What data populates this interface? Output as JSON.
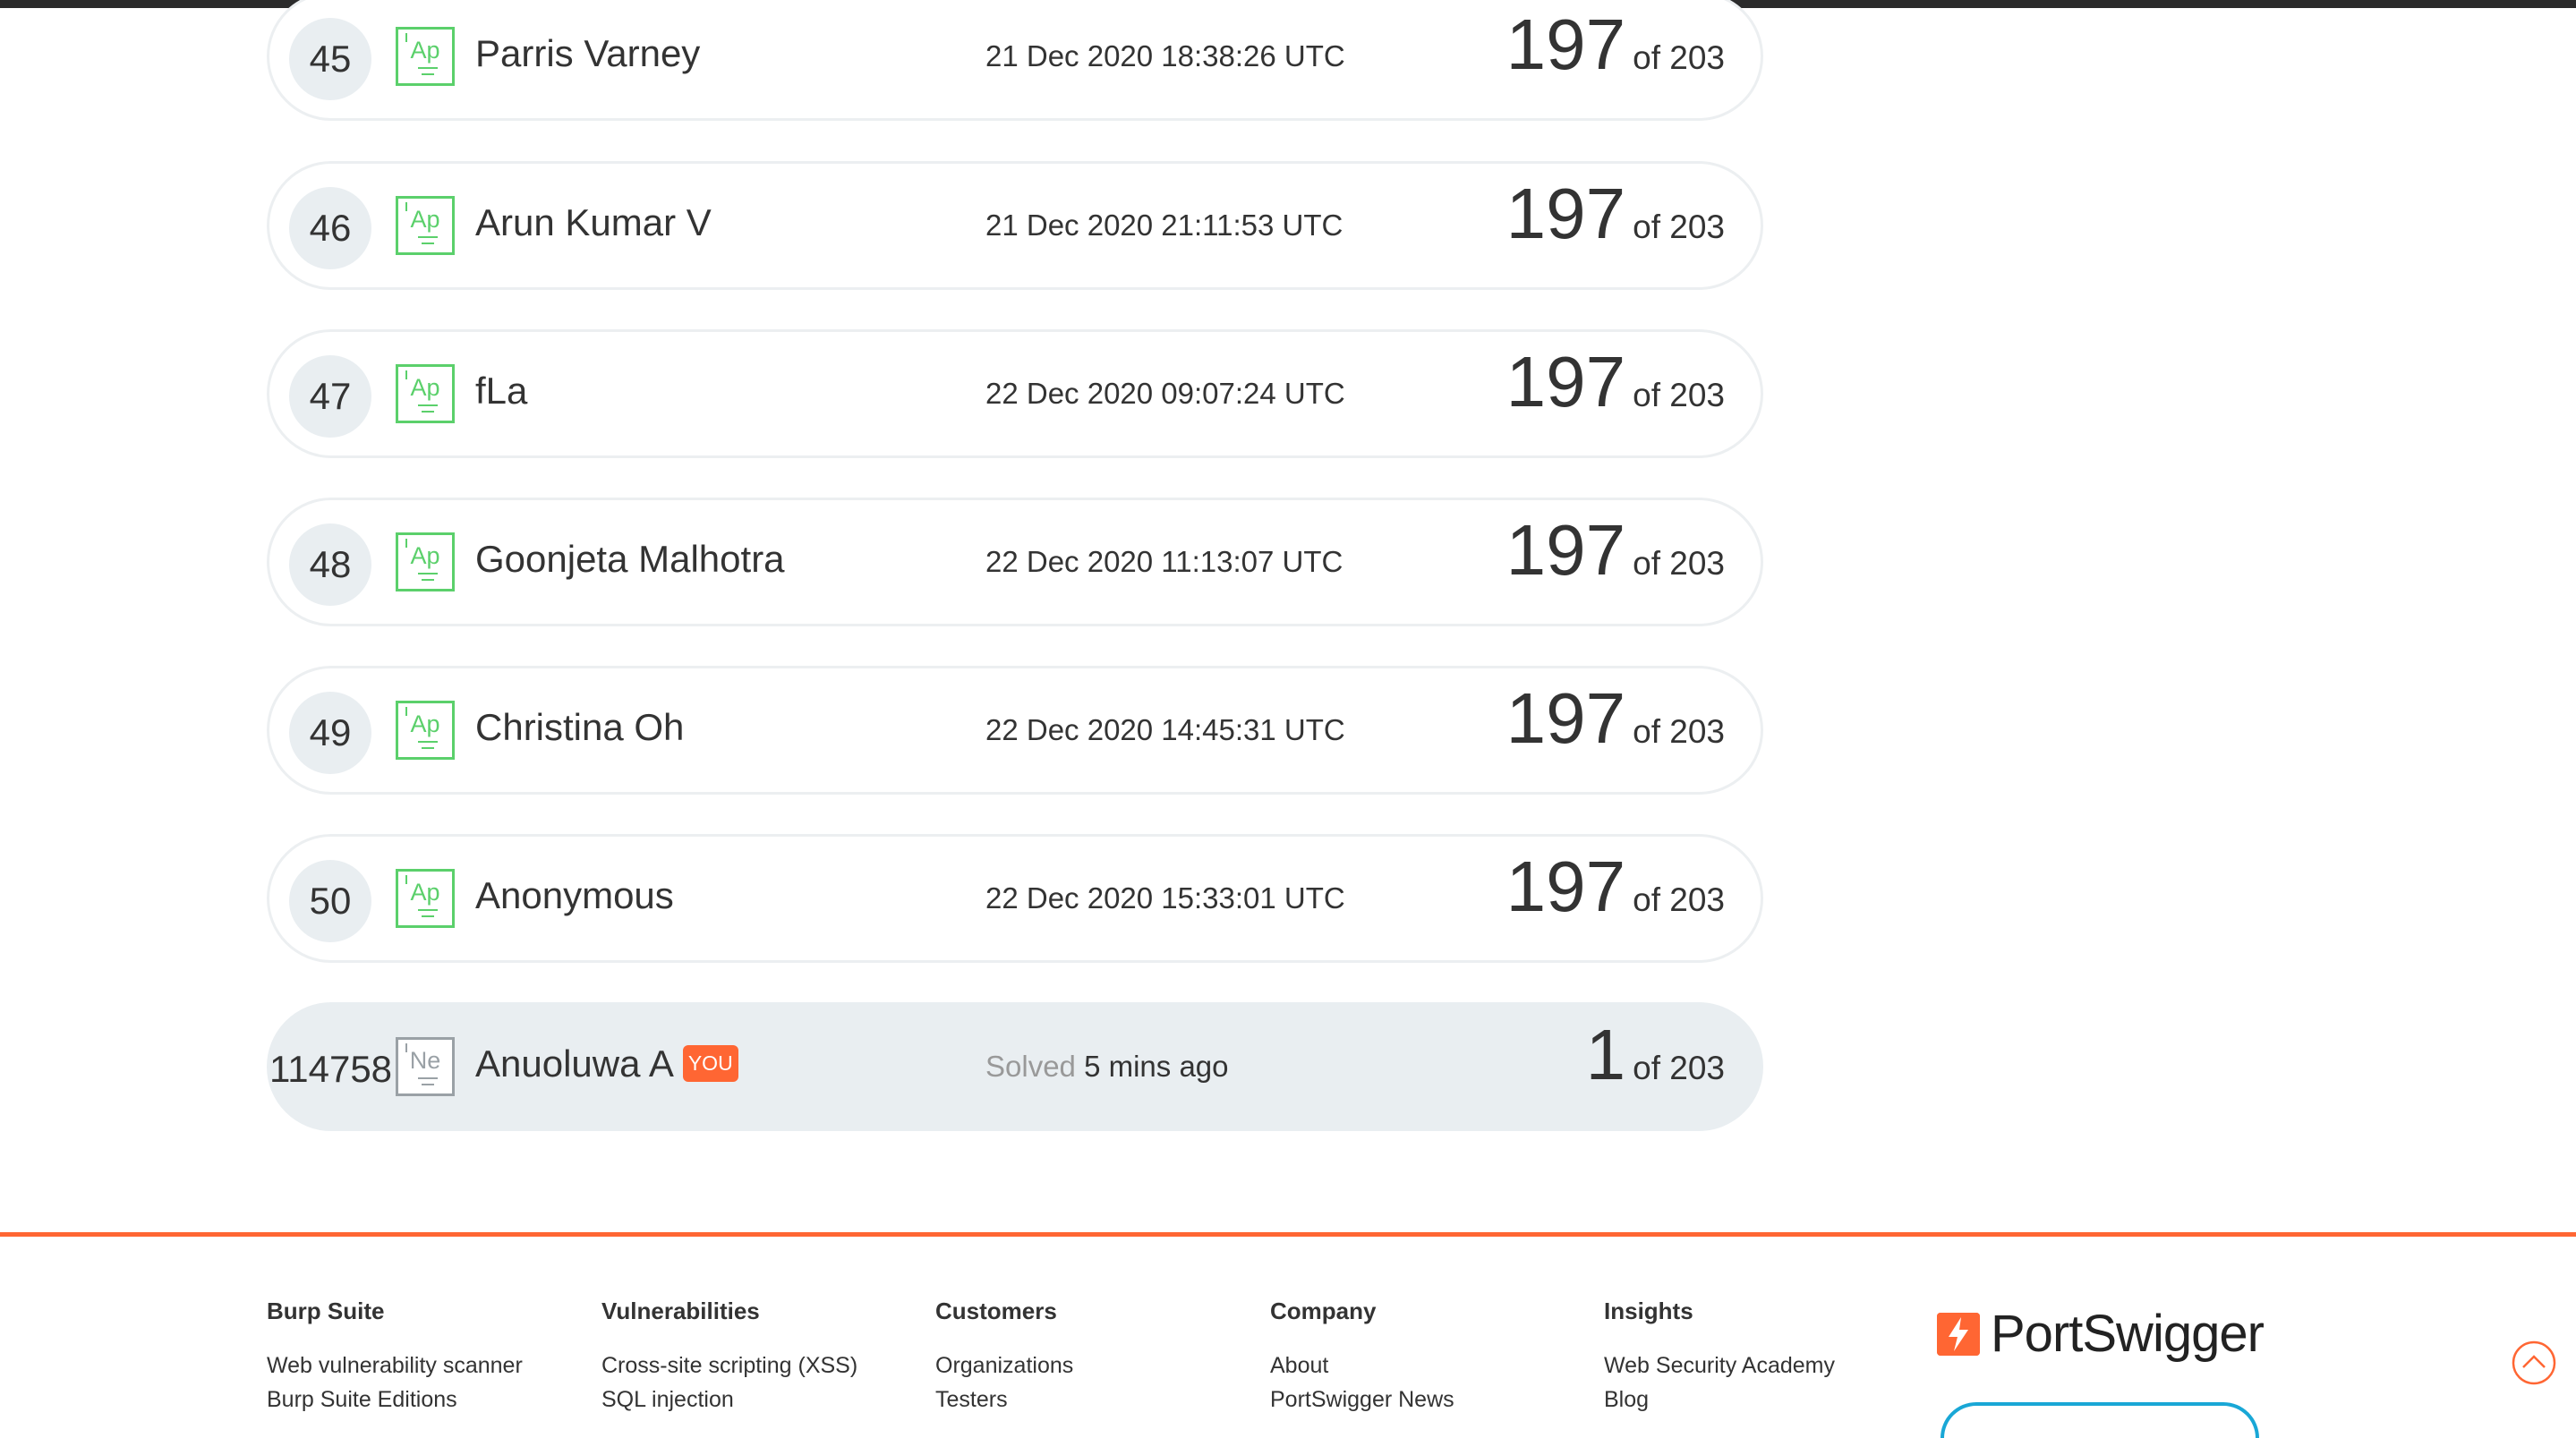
{
  "leaderboard": {
    "rows": [
      {
        "rank": "45",
        "badge": "Ap",
        "name": "Parris Varney",
        "time": "21 Dec 2020 18:38:26 UTC",
        "score": "197",
        "of": "of 203"
      },
      {
        "rank": "46",
        "badge": "Ap",
        "name": "Arun Kumar V",
        "time": "21 Dec 2020 21:11:53 UTC",
        "score": "197",
        "of": "of 203"
      },
      {
        "rank": "47",
        "badge": "Ap",
        "name": "fLa",
        "time": "22 Dec 2020 09:07:24 UTC",
        "score": "197",
        "of": "of 203"
      },
      {
        "rank": "48",
        "badge": "Ap",
        "name": "Goonjeta Malhotra",
        "time": "22 Dec 2020 11:13:07 UTC",
        "score": "197",
        "of": "of 203"
      },
      {
        "rank": "49",
        "badge": "Ap",
        "name": "Christina Oh",
        "time": "22 Dec 2020 14:45:31 UTC",
        "score": "197",
        "of": "of 203"
      },
      {
        "rank": "50",
        "badge": "Ap",
        "name": "Anonymous",
        "time": "22 Dec 2020 15:33:01 UTC",
        "score": "197",
        "of": "of 203"
      }
    ],
    "you": {
      "rank": "114758",
      "badge": "Ne",
      "name": "Anuoluwa A",
      "tag": "YOU",
      "solved_label": "Solved",
      "solved_ago": "5 mins ago",
      "score": "1",
      "of": "of 203"
    }
  },
  "footer": {
    "columns": [
      {
        "heading": "Burp Suite",
        "links": [
          "Web vulnerability scanner",
          "Burp Suite Editions"
        ]
      },
      {
        "heading": "Vulnerabilities",
        "links": [
          "Cross-site scripting (XSS)",
          "SQL injection"
        ]
      },
      {
        "heading": "Customers",
        "links": [
          "Organizations",
          "Testers"
        ]
      },
      {
        "heading": "Company",
        "links": [
          "About",
          "PortSwigger News"
        ]
      },
      {
        "heading": "Insights",
        "links": [
          "Web Security Academy",
          "Blog"
        ]
      }
    ],
    "brand": "PortSwigger"
  },
  "colors": {
    "accent": "#ff6633",
    "badge_green": "#5bd06b",
    "badge_grey": "#9aa1a6",
    "row_border": "#eceff1",
    "you_row_bg": "#e9eef1"
  },
  "icons": {
    "brand_logo": "portswigger-lightning-icon",
    "back_to_top": "chevron-up-icon"
  }
}
